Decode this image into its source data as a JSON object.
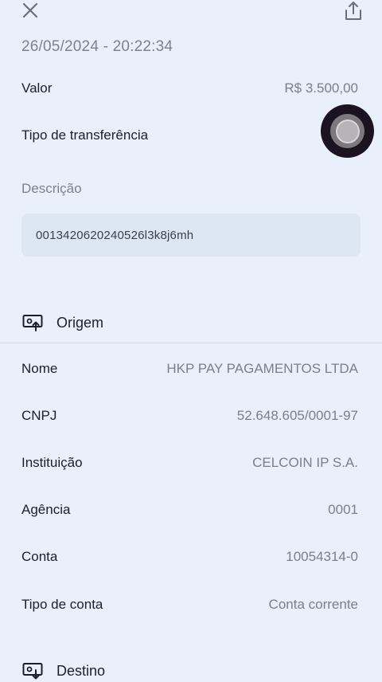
{
  "header": {
    "close_icon": "close-icon",
    "share_icon": "share-icon"
  },
  "datetime": "26/05/2024 - 20:22:34",
  "summary": {
    "valor_label": "Valor",
    "valor_value": "R$ 3.500,00",
    "tipo_label": "Tipo de transferência",
    "descricao_label": "Descrição",
    "descricao_value": "0013420620240526l3k8j6mh"
  },
  "origem": {
    "title": "Origem",
    "icon": "money-out-icon",
    "fields": [
      {
        "label": "Nome",
        "value": "HKP PAY PAGAMENTOS LTDA"
      },
      {
        "label": "CNPJ",
        "value": "52.648.605/0001-97"
      },
      {
        "label": "Instituição",
        "value": "CELCOIN IP S.A."
      },
      {
        "label": "Agência",
        "value": "0001"
      },
      {
        "label": "Conta",
        "value": "10054314-0"
      },
      {
        "label": "Tipo de conta",
        "value": "Conta corrente"
      }
    ]
  },
  "destino": {
    "title": "Destino",
    "icon": "money-in-icon"
  },
  "colors": {
    "background": "#e9f0fb",
    "text_primary": "#1b1f2a",
    "text_secondary": "#7a7f8a",
    "description_box": "#dde6f3"
  }
}
